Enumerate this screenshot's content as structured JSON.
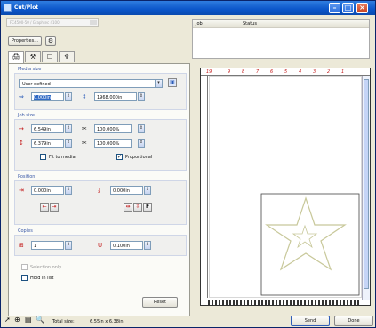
{
  "window": {
    "title": "Cut/Plot",
    "minimize_icon": "minimize-icon",
    "maximize_icon": "maximize-icon",
    "close_icon": "close-icon"
  },
  "device": {
    "selected": "FC4500-50 / Graphtec 4100"
  },
  "toolbar": {
    "properties_label": "Properties..."
  },
  "tabs": [
    {
      "name": "general-tab",
      "icon": "plotter-icon"
    },
    {
      "name": "options-tab",
      "icon": "tool-icon"
    },
    {
      "name": "panel-tab",
      "icon": "panel-icon"
    },
    {
      "name": "weeding-tab",
      "icon": "weed-icon"
    }
  ],
  "media_size": {
    "label": "Media size",
    "preset": "User defined",
    "width": "0.000in",
    "length": "1968.000in"
  },
  "job_size": {
    "label": "Job size",
    "width": "6.549in",
    "height": "6.379in",
    "scale_x": "100.000%",
    "scale_y": "100.000%",
    "fit_to_media_label": "Fit to media",
    "fit_to_media_checked": false,
    "proportional_label": "Proportional",
    "proportional_checked": true
  },
  "position": {
    "label": "Position",
    "x": "0.000in",
    "y": "0.000in"
  },
  "copies": {
    "label": "Copies",
    "count": "1",
    "spacing": "0.100in"
  },
  "options": {
    "selection_only_label": "Selection only",
    "hold_in_list_label": "Hold in list"
  },
  "reset_label": "Reset",
  "status_list": {
    "columns": [
      "Job",
      "Status"
    ]
  },
  "ruler_top_labels": [
    "19",
    "9",
    "8",
    "7",
    "6",
    "5",
    "4",
    "3",
    "2",
    "1"
  ],
  "bottom": {
    "total_size_label": "Total size:",
    "total_size_value": "6.55in x 6.38in",
    "send_label": "Send",
    "done_label": "Done"
  },
  "colors": {
    "title_bar": "#0b56c9",
    "accent_red": "#c41e1e",
    "group_label": "#3b5aa8",
    "selection": "#316ac5"
  }
}
